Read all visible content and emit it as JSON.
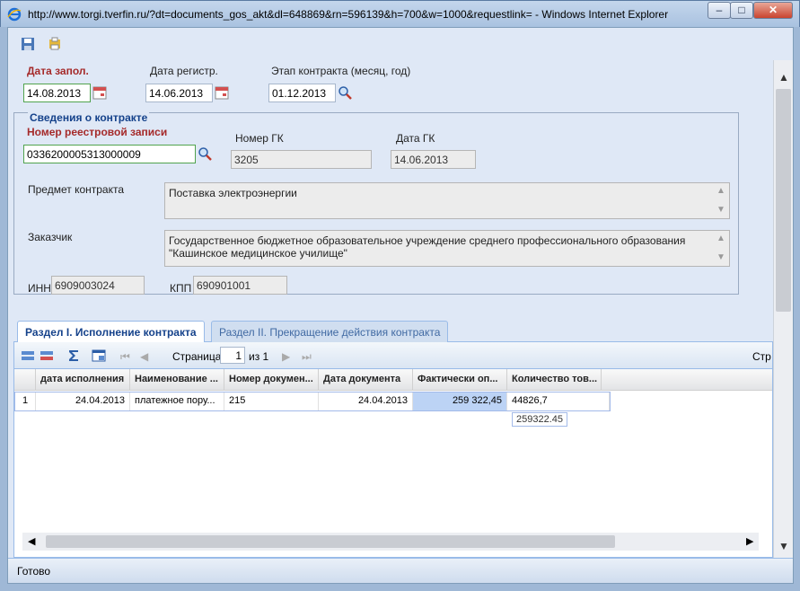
{
  "window": {
    "title": "http://www.torgi.tverfin.ru/?dt=documents_gos_akt&dl=648869&rn=596139&h=700&w=1000&requestlink= - Windows Internet Explorer",
    "min": "–",
    "max": "□",
    "close": "✕"
  },
  "form": {
    "date_filled_label": "Дата запол.",
    "date_filled": "14.08.2013",
    "date_reg_label": "Дата регистр.",
    "date_reg": "14.06.2013",
    "stage_label": "Этап контракта (месяц, год)",
    "stage": "01.12.2013"
  },
  "contract": {
    "legend": "Сведения о контракте",
    "reg_label": "Номер реестровой записи",
    "reg_number": "0336200005313000009",
    "gk_label": "Номер ГК",
    "gk_number": "3205",
    "gk_date_label": "Дата ГК",
    "gk_date": "14.06.2013",
    "subject_label": "Предмет контракта",
    "subject": "Поставка электроэнергии",
    "customer_label": "Заказчик",
    "customer": "Государственное бюджетное образовательное учреждение среднего профессионального образования \"Кашинское медицинское училище\"",
    "inn_label": "ИНН",
    "inn": "6909003024",
    "kpp_label": "КПП",
    "kpp": "690901001"
  },
  "tabs": [
    {
      "label": "Раздел I. Исполнение контракта"
    },
    {
      "label": "Раздел II. Прекращение действия контракта"
    }
  ],
  "pager": {
    "page_label": "Страница",
    "page": "1",
    "of_label": "из 1",
    "right_text": "Стр"
  },
  "grid": {
    "columns": [
      "дата исполнения",
      "Наименование ...",
      "Номер докумен...",
      "Дата документа",
      "Фактически оп...",
      "Количество тов..."
    ],
    "rows": [
      {
        "num": "1",
        "cells": [
          "24.04.2013",
          "платежное пору...",
          "215",
          "24.04.2013",
          "259 322,45",
          "44826,7"
        ]
      }
    ],
    "tooltip": "259322.45"
  },
  "status": "Готово",
  "colors": {
    "accent": "#15428b",
    "required": "#a52a2a"
  }
}
